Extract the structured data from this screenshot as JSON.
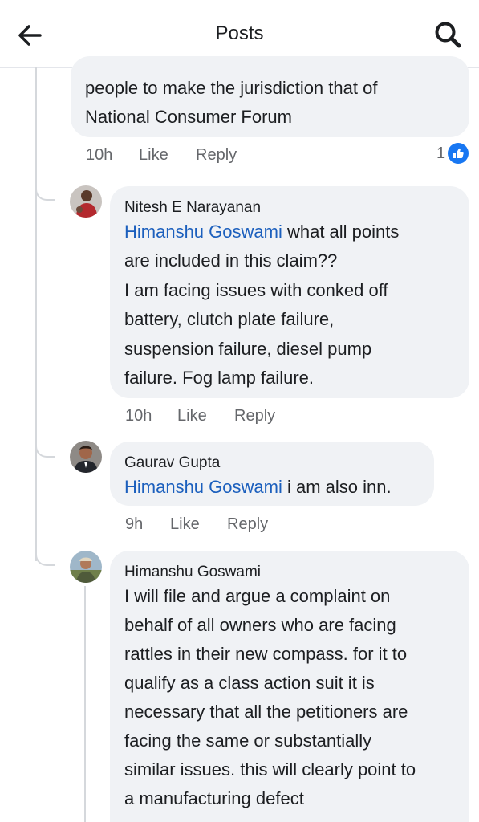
{
  "header": {
    "title": "Posts",
    "back_icon": "arrow-left-icon",
    "search_icon": "search-icon"
  },
  "comments": [
    {
      "lines": [
        "people to make the jurisdiction that of",
        "National Consumer Forum"
      ],
      "time": "10h",
      "like": "Like",
      "reply": "Reply",
      "reaction_count": "1"
    },
    {
      "author": "Nitesh E Narayanan",
      "mention": "Himanshu Goswami",
      "first_rest": " what all points",
      "lines": [
        "are included in this claim??",
        "I am facing issues with conked off",
        "battery, clutch plate failure,",
        "suspension failure, diesel pump",
        "failure. Fog lamp failure."
      ],
      "time": "10h",
      "like": "Like",
      "reply": "Reply"
    },
    {
      "author": "Gaurav Gupta",
      "mention": "Himanshu Goswami",
      "first_rest": " i am also inn.",
      "time": "9h",
      "like": "Like",
      "reply": "Reply"
    },
    {
      "author": "Himanshu Goswami",
      "lines": [
        "I will file and argue a complaint on",
        "behalf of all owners who are facing",
        "rattles in their new compass. for it to",
        "qualify as a class action suit it is",
        "necessary that all the petitioners are",
        "facing the same or substantially",
        "similar issues. this will clearly point to",
        "a manufacturing defect"
      ]
    }
  ],
  "colors": {
    "mention": "#1b5fbd",
    "bubble": "#f0f2f5",
    "like_badge": "#1877f2",
    "meta": "#65676b"
  }
}
